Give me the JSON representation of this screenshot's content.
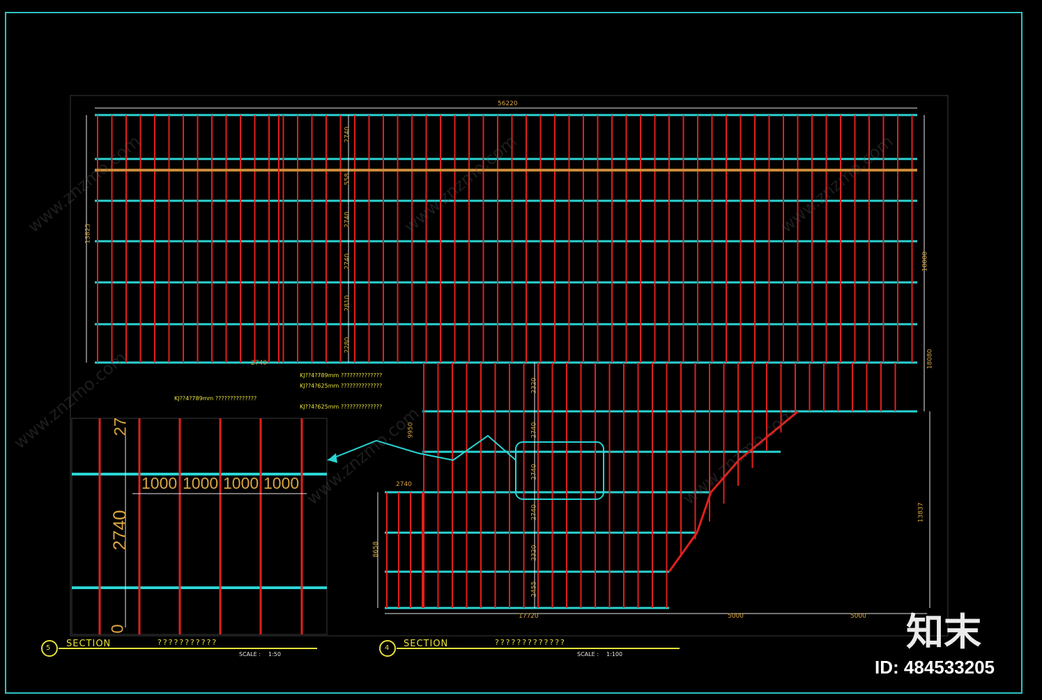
{
  "drawing": {
    "overall_width_label": "56220",
    "left_height_label": "13825",
    "right_height_label": "18080",
    "right_lower_label": "13837",
    "bottom_width_left": "17720",
    "bottom_width_mid": "5000",
    "bottom_width_right": "5000",
    "bottom_left_height": "8658",
    "row_dims": [
      "2740",
      "558",
      "2740",
      "2740",
      "2810",
      "2280"
    ],
    "mid_row_dims": [
      "2320",
      "2740",
      "2740",
      "2740",
      "2320",
      "2455"
    ],
    "small_dims": [
      "2740",
      "2740",
      "9950"
    ],
    "callouts": [
      "KJ??4?789mm ??????????????",
      "KJ??4?625mm ??????????????",
      "KJ??4?789mm ??????????????",
      "KJ??4?625mm ??????????????"
    ]
  },
  "detail": {
    "spacing_labels": [
      "1000",
      "1000",
      "1000",
      "1000"
    ],
    "row_height_label": "2740",
    "top_label": "27",
    "bottom_label": "0"
  },
  "sections": [
    {
      "number": "5",
      "label": "SECTION",
      "title": "???????????",
      "scale_label": "SCALE :",
      "scale_value": "1:50"
    },
    {
      "number": "4",
      "label": "SECTION",
      "title": "?????????????",
      "scale_label": "SCALE :",
      "scale_value": "1:100"
    }
  ],
  "watermark": {
    "brand": "知末",
    "id_text": "ID: 484533205",
    "url": "www.znzmo.com"
  },
  "colors": {
    "bg": "#000000",
    "frame": "#2fc2c2",
    "rafter": "#e0201d",
    "purlin": "#2ad4d4",
    "dim": "#e8e8e8",
    "text": "#d9a441",
    "title": "#e8e23a"
  }
}
